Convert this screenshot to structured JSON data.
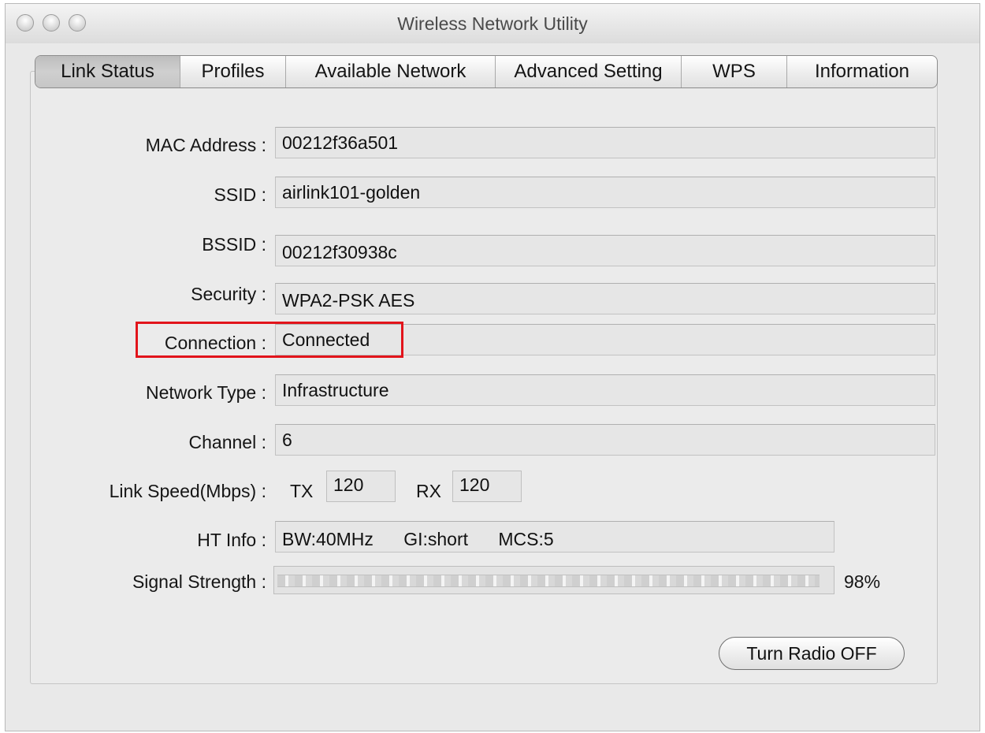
{
  "window": {
    "title": "Wireless Network Utility"
  },
  "tabs": [
    {
      "label": "Link Status",
      "active": true
    },
    {
      "label": "Profiles",
      "active": false
    },
    {
      "label": "Available Network",
      "active": false
    },
    {
      "label": "Advanced Setting",
      "active": false
    },
    {
      "label": "WPS",
      "active": false
    },
    {
      "label": "Information",
      "active": false
    }
  ],
  "fields": {
    "mac": {
      "label": "MAC Address :",
      "value": "00212f36a501"
    },
    "ssid": {
      "label": "SSID :",
      "value": "airlink101-golden"
    },
    "bssid": {
      "label": "BSSID :",
      "value": "00212f30938c"
    },
    "security": {
      "label": "Security :",
      "value": "WPA2-PSK AES"
    },
    "connection": {
      "label": "Connection :",
      "value": "Connected"
    },
    "network_type": {
      "label": "Network Type :",
      "value": "Infrastructure"
    },
    "channel": {
      "label": "Channel :",
      "value": "6"
    },
    "link_speed": {
      "label": "Link Speed(Mbps) :",
      "tx_label": "TX",
      "tx_value": "120",
      "rx_label": "RX",
      "rx_value": "120"
    },
    "ht_info": {
      "label": "HT Info :",
      "value": "BW:40MHz      GI:short      MCS:5"
    },
    "signal": {
      "label": "Signal Strength :",
      "percent_text": "98%",
      "level": 0.98
    }
  },
  "buttons": {
    "turn_radio_off": "Turn Radio OFF"
  },
  "colors": {
    "highlight": "#e2141b"
  }
}
